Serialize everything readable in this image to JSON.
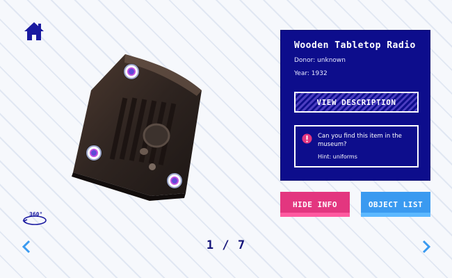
{
  "nav": {
    "home_icon": "home-icon",
    "prev_icon": "chevron-left-icon",
    "next_icon": "chevron-right-icon"
  },
  "viewer": {
    "rotate_label": "360°",
    "rotate_icon": "rotate-360-icon",
    "hotspot_icon": "hotspot-marker-icon"
  },
  "pager": {
    "text": "1 / 7",
    "current": 1,
    "total": 7
  },
  "info": {
    "title": "Wooden Tabletop Radio",
    "donor": "Donor: unknown",
    "year": "Year: 1932",
    "view_description": "VIEW DESCRIPTION",
    "challenge": "Can you find this item in the museum?",
    "hint": "Hint: uniforms",
    "alert_icon": "alert-icon"
  },
  "actions": {
    "hide_info": "HIDE INFO",
    "object_list": "OBJECT LIST"
  },
  "colors": {
    "panel": "#0d0d8c",
    "pink": "#e3367f",
    "blue": "#3a9af0",
    "nav": "#1a1aa0",
    "arrow": "#3a9af0"
  }
}
